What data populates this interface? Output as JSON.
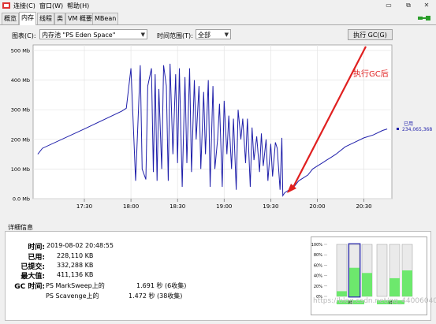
{
  "menu": {
    "items": [
      "连接(C)",
      "窗口(W)",
      "帮助(H)"
    ]
  },
  "window_buttons": [
    "▭",
    "⧉",
    "✕"
  ],
  "tabs": [
    "概览",
    "内存",
    "线程",
    "类",
    "VM 概要",
    "MBean"
  ],
  "active_tab": "内存",
  "controls": {
    "chart_label": "图表(C):",
    "chart_value": "内存池 \"PS Eden Space\"",
    "range_label": "时间范围(T):",
    "range_value": "全部",
    "gc_button": "执行 GC(G)"
  },
  "annotation": "执行GC后",
  "chart_data": {
    "type": "line",
    "y_tick_labels": [
      "500 Mb",
      "400 Mb",
      "300 Mb",
      "200 Mb",
      "100 Mb",
      "0.0 Mb"
    ],
    "ylim": [
      0,
      500
    ],
    "x_tick_labels": [
      "17:30",
      "18:00",
      "18:30",
      "19:00",
      "19:30",
      "20:00",
      "20:30"
    ],
    "series": [
      {
        "name": "已用",
        "color": "#1f1faa",
        "current_value": "234,065,368",
        "x": [
          17.0,
          17.05,
          17.5,
          17.9,
          17.95,
          18.0,
          18.05,
          18.1,
          18.12,
          18.16,
          18.18,
          18.22,
          18.24,
          18.26,
          18.28,
          18.3,
          18.33,
          18.35,
          18.38,
          18.4,
          18.42,
          18.45,
          18.48,
          18.5,
          18.52,
          18.55,
          18.58,
          18.6,
          18.63,
          18.65,
          18.68,
          18.7,
          18.73,
          18.75,
          18.78,
          18.8,
          18.83,
          18.85,
          18.88,
          18.9,
          18.93,
          18.95,
          18.98,
          19.0,
          19.03,
          19.05,
          19.08,
          19.1,
          19.13,
          19.15,
          19.18,
          19.2,
          19.23,
          19.25,
          19.28,
          19.3,
          19.32,
          19.35,
          19.38,
          19.4,
          19.42,
          19.45,
          19.47,
          19.5,
          19.52,
          19.55,
          19.57,
          19.6,
          19.62,
          19.63,
          19.65,
          19.7,
          19.75,
          19.8,
          19.85,
          19.9,
          19.95,
          20.0,
          20.05,
          20.1,
          20.15,
          20.2,
          20.3,
          20.4,
          20.5,
          20.6,
          20.7,
          20.75
        ],
        "y": [
          150,
          170,
          235,
          295,
          305,
          440,
          60,
          450,
          100,
          65,
          380,
          440,
          90,
          420,
          60,
          370,
          100,
          450,
          380,
          60,
          455,
          150,
          420,
          120,
          440,
          40,
          410,
          120,
          440,
          90,
          400,
          200,
          380,
          100,
          360,
          150,
          400,
          40,
          380,
          100,
          200,
          320,
          40,
          330,
          150,
          280,
          100,
          270,
          30,
          300,
          200,
          270,
          120,
          270,
          40,
          240,
          130,
          210,
          90,
          220,
          110,
          200,
          60,
          185,
          75,
          190,
          170,
          30,
          205,
          10,
          20,
          30,
          40,
          60,
          70,
          80,
          100,
          110,
          120,
          130,
          140,
          150,
          175,
          190,
          205,
          215,
          230,
          235
        ]
      }
    ]
  },
  "details": {
    "title": "详细信息",
    "time_label": "时间:",
    "time_value": "2019-08-02 20:48:55",
    "used_label": "已用:",
    "used_value": "228,110 KB",
    "committed_label": "已提交:",
    "committed_value": "332,288 KB",
    "max_label": "最大值:",
    "max_value": "411,136 KB",
    "gc_label": "GC 时间:",
    "gc1_name": "PS MarkSweep上的",
    "gc1_value": "1.691 秒 (6收集)",
    "gc2_name": "PS Scavenge上的",
    "gc2_value": "1.472 秒 (38收集)"
  },
  "bar_panel": {
    "y_tick_labels": [
      "100%",
      "80%",
      "60%",
      "40%",
      "20%",
      "0%"
    ],
    "group_labels": [
      "M",
      "M"
    ],
    "watermark": "https://blog.csdn.net/qq_44006040",
    "bar_fills": [
      0.1,
      0.55,
      0.45,
      0.0,
      0.35,
      0.5
    ],
    "bar_color": "#6de86d"
  }
}
